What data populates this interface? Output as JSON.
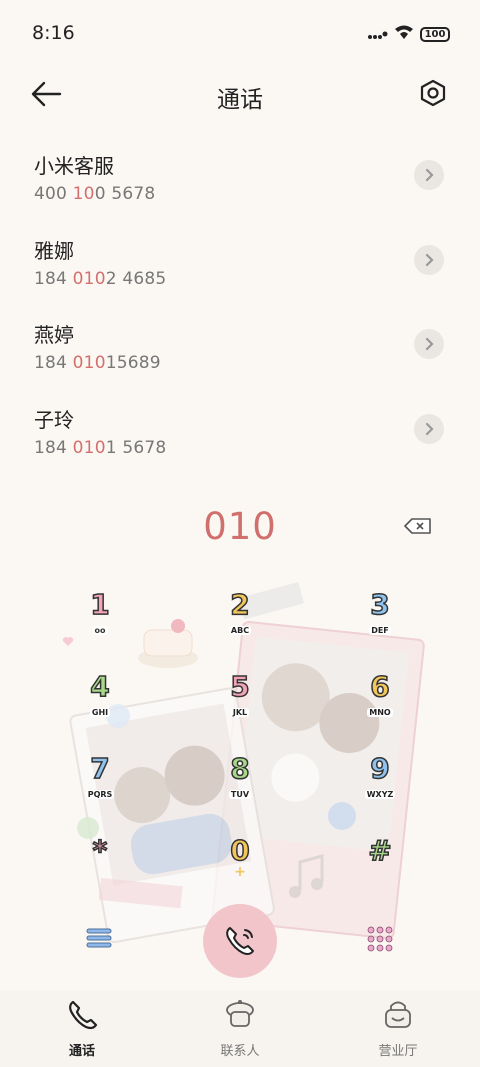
{
  "status_bar": {
    "time": "8:16",
    "battery": "100"
  },
  "header": {
    "title": "通话"
  },
  "contacts": [
    {
      "name": "小米客服",
      "num_pre": "400 ",
      "num_hl": "10",
      "num_post": "0 5678"
    },
    {
      "name": "雅娜",
      "num_pre": "184 ",
      "num_hl": "010",
      "num_post": "2 4685"
    },
    {
      "name": "燕婷",
      "num_pre": "184 ",
      "num_hl": "010",
      "num_post": "15689"
    },
    {
      "name": "子玲",
      "num_pre": "184 ",
      "num_hl": "010",
      "num_post": "1 5678"
    }
  ],
  "dial": {
    "number": "010"
  },
  "keypad": [
    {
      "digit": "1",
      "letters": "oo",
      "color": "#f3a3b8"
    },
    {
      "digit": "2",
      "letters": "ABC",
      "color": "#f2c65a"
    },
    {
      "digit": "3",
      "letters": "DEF",
      "color": "#8fc3ef"
    },
    {
      "digit": "4",
      "letters": "GHI",
      "color": "#a8d88a"
    },
    {
      "digit": "5",
      "letters": "JKL",
      "color": "#f3a3b8"
    },
    {
      "digit": "6",
      "letters": "MNO",
      "color": "#f2c65a"
    },
    {
      "digit": "7",
      "letters": "PQRS",
      "color": "#8fc3ef"
    },
    {
      "digit": "8",
      "letters": "TUV",
      "color": "#a8d88a"
    },
    {
      "digit": "9",
      "letters": "WXYZ",
      "color": "#8fc3ef"
    },
    {
      "digit": "*",
      "letters": "",
      "color": "#f3a3b8"
    },
    {
      "digit": "0",
      "letters": "+",
      "color": "#f2c65a"
    },
    {
      "digit": "#",
      "letters": "",
      "color": "#a8d88a"
    }
  ],
  "tabs": [
    {
      "label": "通话",
      "icon": "phone-icon",
      "active": true
    },
    {
      "label": "联系人",
      "icon": "contacts-icon",
      "active": false
    },
    {
      "label": "营业厅",
      "icon": "store-icon",
      "active": false
    }
  ],
  "colors": {
    "accent": "#d0706d",
    "call_button": "#f2c5cb",
    "background": "#fbf8f4"
  }
}
